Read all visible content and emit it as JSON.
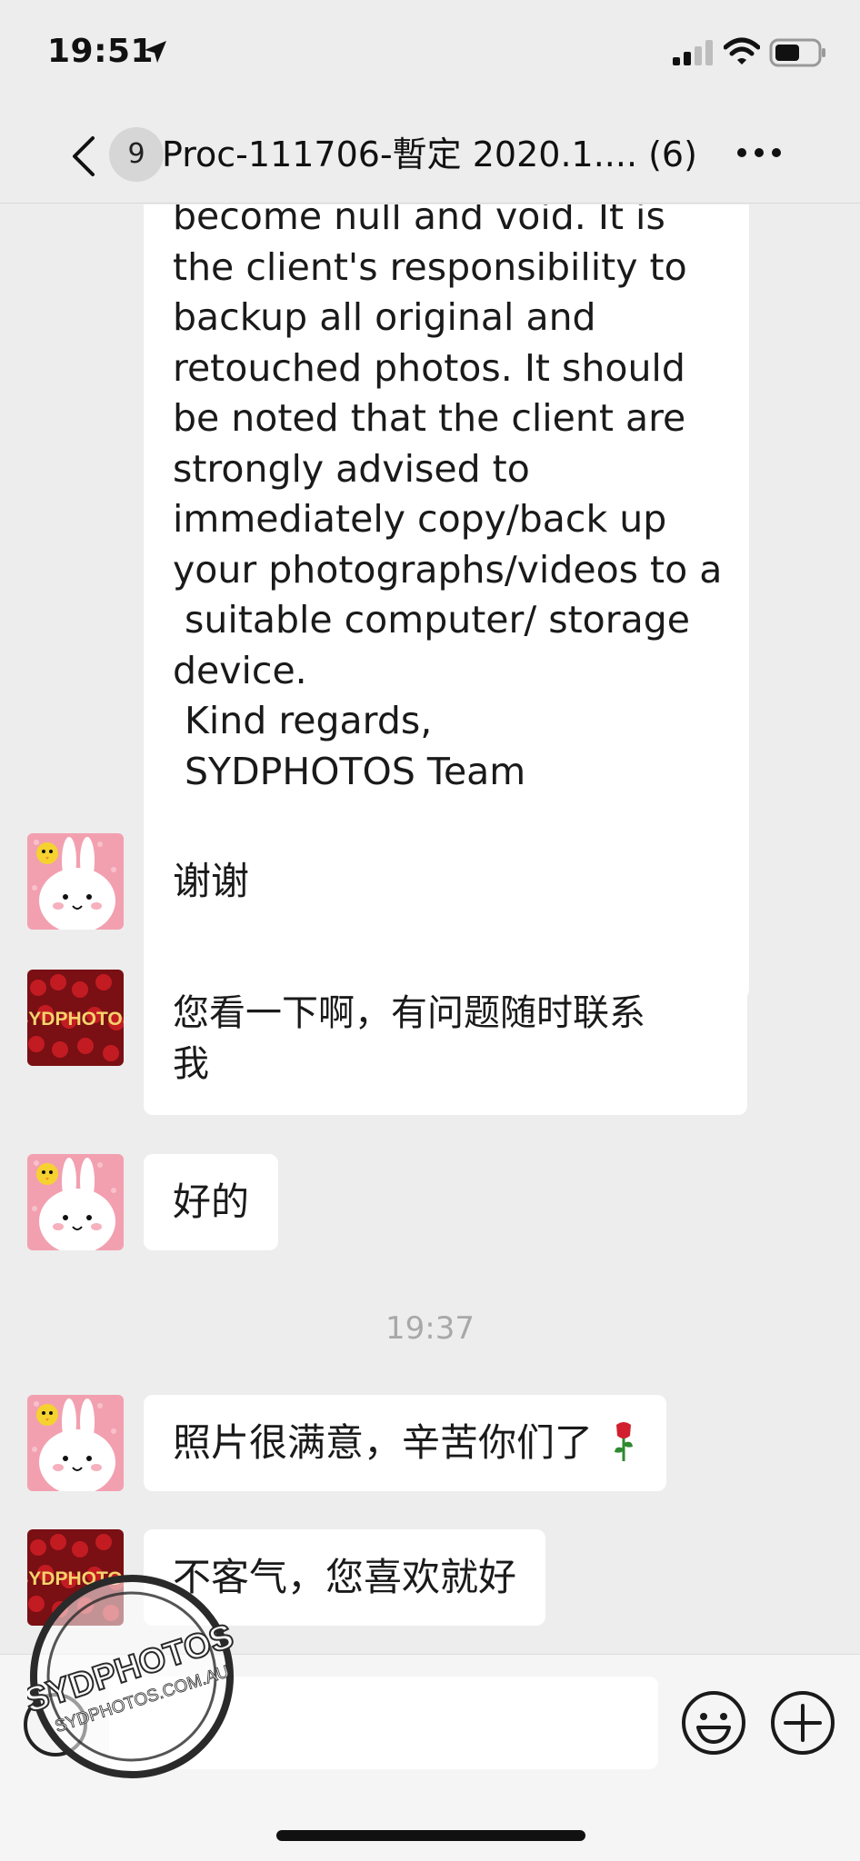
{
  "status_bar": {
    "time": "19:51"
  },
  "nav": {
    "unread_count": "9",
    "title": "Proc-111706-暫定 2020.1.... (6)"
  },
  "messages": {
    "long_lines": [
      "become null and void. It is",
      "the client's responsibility to",
      "backup all original and",
      "retouched photos. It should",
      "be noted that the client are",
      "strongly advised to",
      "immediately copy/back up",
      "your photographs/videos to a",
      " suitable computer/ storage",
      "device.",
      " Kind regards,",
      " SYDPHOTOS Team"
    ],
    "m1": "谢谢",
    "m2_line1": "您看一下啊，有问题随时联系",
    "m2_line2": "我",
    "m3": "好的",
    "timestamp": "19:37",
    "m4": "照片很满意，辛苦你们了",
    "m5": "不客气，您喜欢就好"
  },
  "avatars": {
    "vendor_text": "SYDPHOTOS"
  },
  "watermark": {
    "brand_top": "SYDPHOTOS",
    "brand_url": "SYDPHOTOS.COM.AU"
  },
  "colors": {
    "background": "#ededed",
    "bubble": "#ffffff",
    "timestamp": "#a8a8a8",
    "rose": "#d21f2f"
  },
  "icons": [
    "location-arrow-icon",
    "signal-icon",
    "wifi-icon",
    "battery-icon",
    "back-chevron-icon",
    "more-icon",
    "voice-icon",
    "emoji-icon",
    "plus-icon",
    "rose-icon"
  ]
}
